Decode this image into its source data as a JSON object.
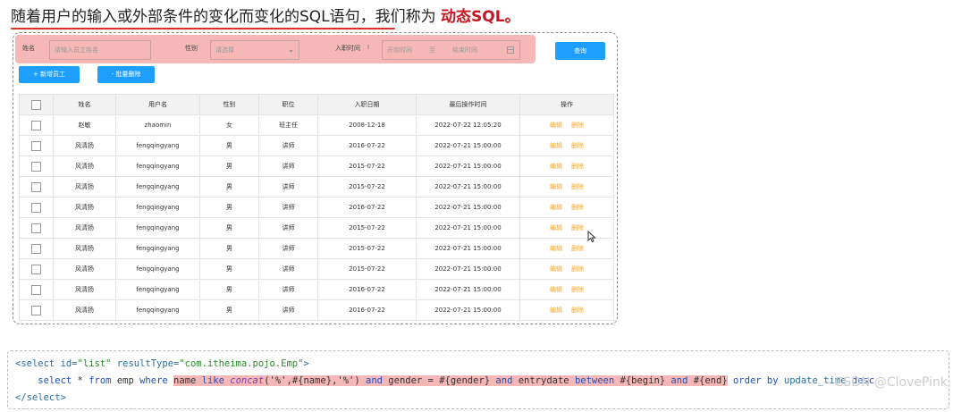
{
  "headline": {
    "text": "随着用户的输入或外部条件的变化而变化的SQL语句，我们称为 ",
    "highlight": "动态SQL。"
  },
  "search": {
    "name_label": "姓名",
    "name_placeholder": "请输入员工姓名",
    "gender_label": "性别",
    "gender_placeholder": "请选择",
    "date_label": "入职时间",
    "date_start_placeholder": "开始时间",
    "date_sep": "至",
    "date_end_placeholder": "结束时间",
    "query_button": "查询"
  },
  "actions": {
    "add_button": "+ 新增员工",
    "batch_delete_button": "- 批量删除"
  },
  "table": {
    "headers": [
      "姓名",
      "用户名",
      "性别",
      "职位",
      "入职日期",
      "最后操作时间",
      "操作"
    ],
    "edit_label": "编辑",
    "delete_label": "删除",
    "rows": [
      [
        "赵敏",
        "zhaomin",
        "女",
        "班主任",
        "2008-12-18",
        "2022-07-22 12:05:20"
      ],
      [
        "风清扬",
        "fengqingyang",
        "男",
        "讲师",
        "2016-07-22",
        "2022-07-21 15:00:00"
      ],
      [
        "风清扬",
        "fengqingyang",
        "男",
        "讲师",
        "2015-07-22",
        "2022-07-21 15:00:00"
      ],
      [
        "风清扬",
        "fengqingyang",
        "男",
        "讲师",
        "2015-07-22",
        "2022-07-21 15:00:00"
      ],
      [
        "风清扬",
        "fengqingyang",
        "男",
        "讲师",
        "2016-07-22",
        "2022-07-21 15:00:00"
      ],
      [
        "风清扬",
        "fengqingyang",
        "男",
        "讲师",
        "2015-07-22",
        "2022-07-21 15:00:00"
      ],
      [
        "风清扬",
        "fengqingyang",
        "男",
        "讲师",
        "2015-07-22",
        "2022-07-21 15:00:00"
      ],
      [
        "风清扬",
        "fengqingyang",
        "男",
        "讲师",
        "2015-07-22",
        "2022-07-21 15:00:00"
      ],
      [
        "风清扬",
        "fengqingyang",
        "男",
        "讲师",
        "2016-07-22",
        "2022-07-21 15:00:00"
      ],
      [
        "风清扬",
        "fengqingyang",
        "男",
        "讲师",
        "2016-07-22",
        "2022-07-21 15:00:00"
      ]
    ]
  },
  "code": {
    "line1_open": "<select ",
    "line1_id_attr": "id=",
    "line1_id_val": "\"list\"",
    "line1_rt_attr": " resultType=",
    "line1_rt_val": "\"com.itheima.pojo.Emp\"",
    "line1_close": ">",
    "line2_indent": "    ",
    "line2_select": "select",
    "line2_star": " * ",
    "line2_from": "from",
    "line2_emp": " emp ",
    "line2_where": "where",
    "line2_sp": " ",
    "hl_name": "name ",
    "hl_like": "like",
    "hl_concat": " concat",
    "hl_args": "('%',#{name},'%') ",
    "hl_and1": "and",
    "hl_gender": " gender = #{gender} ",
    "hl_and2": "and",
    "hl_entry": " entrydate ",
    "hl_between": "between",
    "hl_begin": " #{begin} ",
    "hl_and3": "and",
    "hl_end": " #{end}",
    "line2_order": " order by",
    "line2_update": " update_time",
    "line2_desc": " desc",
    "line3": "</select>"
  },
  "watermark": "CSDN @ClovePink",
  "colors": {
    "primary": "#1e9fff",
    "highlight_bg": "#f6b7b7",
    "op_link": "#f5a623",
    "title_accent": "#c7161f"
  }
}
